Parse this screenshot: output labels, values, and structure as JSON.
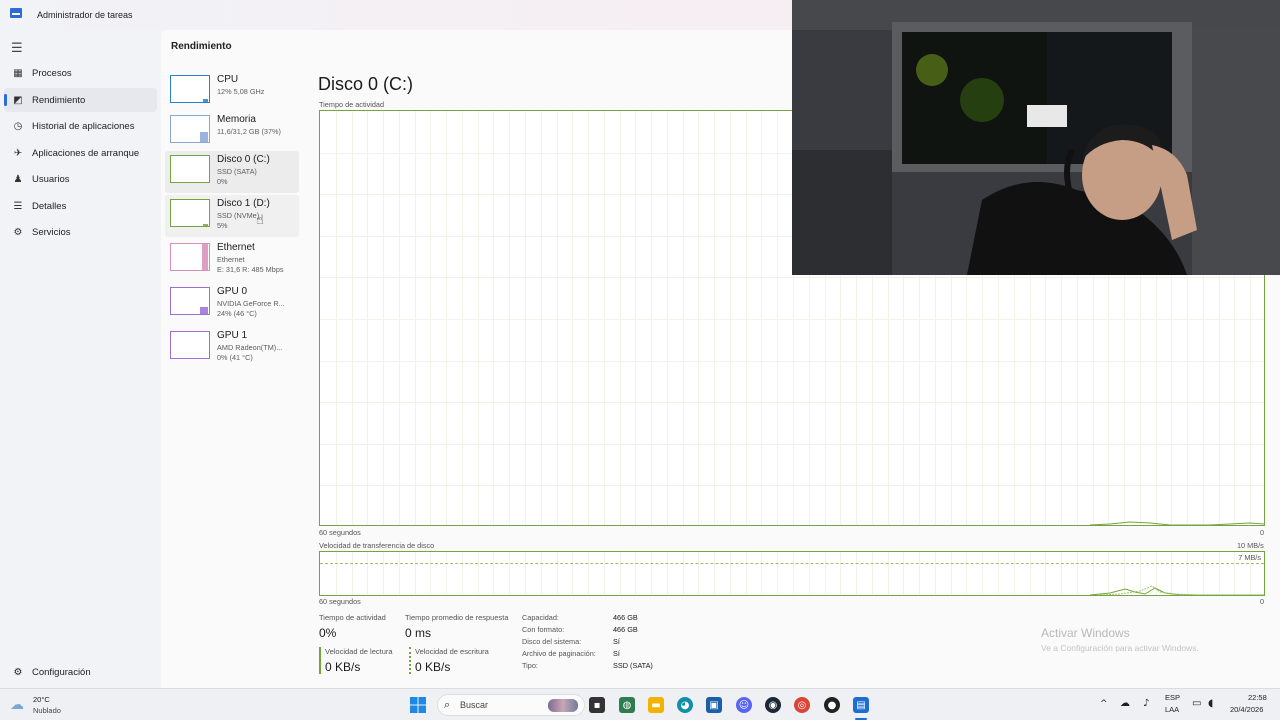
{
  "window": {
    "title": "Administrador de tareas"
  },
  "nav": {
    "items": [
      {
        "label": "Procesos",
        "icon": "processes-icon",
        "glyph": "▦"
      },
      {
        "label": "Rendimiento",
        "icon": "performance-icon",
        "glyph": "◩"
      },
      {
        "label": "Historial de aplicaciones",
        "icon": "history-icon",
        "glyph": "◷"
      },
      {
        "label": "Aplicaciones de arranque",
        "icon": "startup-icon",
        "glyph": "✈"
      },
      {
        "label": "Usuarios",
        "icon": "users-icon",
        "glyph": "♟"
      },
      {
        "label": "Detalles",
        "icon": "details-icon",
        "glyph": "☰"
      },
      {
        "label": "Servicios",
        "icon": "services-icon",
        "glyph": "⚙"
      }
    ],
    "settings": {
      "label": "Configuración",
      "glyph": "⚙"
    }
  },
  "section_title": "Rendimiento",
  "resources": [
    {
      "name": "CPU",
      "line1": "12% 5,08 GHz",
      "line2": "",
      "level": 0.12,
      "color": "#2a7fc9"
    },
    {
      "name": "Memoria",
      "line1": "11,6/31,2 GB (37%)",
      "line2": "",
      "level": 0.37,
      "color": "#8aa6d9"
    },
    {
      "name": "Disco 0 (C:)",
      "line1": "SSD (SATA)",
      "line2": "0%",
      "level": 0,
      "color": "#74a43d"
    },
    {
      "name": "Disco 1 (D:)",
      "line1": "SSD (NVMe)",
      "line2": "5%",
      "level": 0.05,
      "color": "#74a43d"
    },
    {
      "name": "Ethernet",
      "line1": "Ethernet",
      "line2": "E: 31,6 R: 485 Mbps",
      "level": 1,
      "color": "#d690b7"
    },
    {
      "name": "GPU 0",
      "line1": "NVIDIA GeForce R...",
      "line2": "24% (46 °C)",
      "level": 0.24,
      "color": "#9b6fd4"
    },
    {
      "name": "GPU 1",
      "line1": "AMD Radeon(TM)...",
      "line2": "0% (41 °C)",
      "level": 0,
      "color": "#9b6fd4"
    }
  ],
  "disk": {
    "title": "Disco 0 (C:)",
    "activity_label": "Tiempo de actividad",
    "seconds_label_1": "60 segundos",
    "zero_label_1": "0",
    "transfer_label": "Velocidad de transferencia de disco",
    "transfer_max": "10 MB/s",
    "transfer_mark": "7 MB/s",
    "seconds_label_2": "60 segundos",
    "zero_label_2": "0",
    "stats": {
      "active_time_label": "Tiempo de actividad",
      "active_time_value": "0%",
      "response_label": "Tiempo promedio de respuesta",
      "response_value": "0 ms",
      "read_label": "Velocidad de lectura",
      "read_value": "0 KB/s",
      "write_label": "Velocidad de escritura",
      "write_value": "0 KB/s"
    },
    "props": [
      {
        "key": "Capacidad:",
        "value": "466 GB"
      },
      {
        "key": "Con formato:",
        "value": "466 GB"
      },
      {
        "key": "Disco del sistema:",
        "value": "Sí"
      },
      {
        "key": "Archivo de paginación:",
        "value": "Sí"
      },
      {
        "key": "Tipo:",
        "value": "SSD (SATA)"
      }
    ]
  },
  "watermark": {
    "line1": "Activar Windows",
    "line2": "Ve a Configuración para activar Windows."
  },
  "taskbar": {
    "weather_temp": "20°C",
    "weather_desc": "Nublado",
    "search_placeholder": "Buscar",
    "lang_top": "ESP",
    "lang_bottom": "LAA",
    "time": "22:58",
    "date": "20/4/2026"
  }
}
